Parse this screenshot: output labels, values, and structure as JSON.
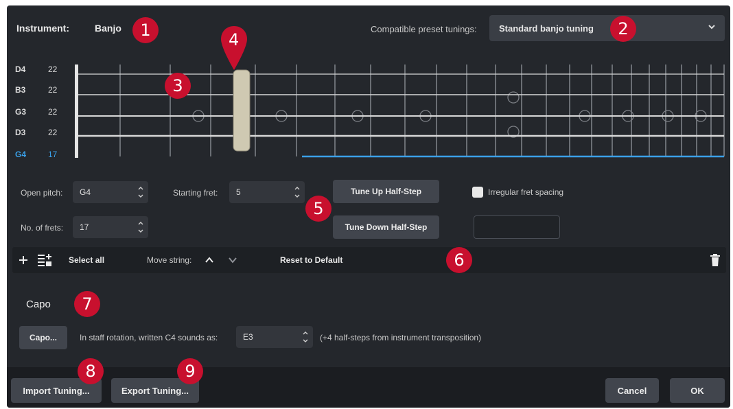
{
  "header": {
    "instrument_label": "Instrument:",
    "instrument_value": "Banjo",
    "preset_label": "Compatible preset tunings:",
    "preset_value": "Standard banjo tuning"
  },
  "strings": [
    {
      "name": "D4",
      "frets": "22",
      "highlight": false
    },
    {
      "name": "B3",
      "frets": "22",
      "highlight": false
    },
    {
      "name": "G3",
      "frets": "22",
      "highlight": false
    },
    {
      "name": "D3",
      "frets": "22",
      "highlight": false
    },
    {
      "name": "G4",
      "frets": "17",
      "highlight": true
    }
  ],
  "fields": {
    "open_pitch_label": "Open pitch:",
    "open_pitch_value": "G4",
    "starting_fret_label": "Starting fret:",
    "starting_fret_value": "5",
    "frets_label": "No. of frets:",
    "frets_value": "17",
    "tune_up": "Tune Up Half-Step",
    "tune_down": "Tune Down Half-Step",
    "irregular_label": "Irregular fret spacing"
  },
  "toolbar": {
    "select_all": "Select all",
    "move_string": "Move string:",
    "reset": "Reset to Default"
  },
  "capo": {
    "heading": "Capo",
    "button": "Capo...",
    "sounds_label": "In staff rotation, written C4 sounds as:",
    "sounds_value": "E3",
    "note": "(+4 half-steps from instrument transposition)"
  },
  "footer": {
    "import": "Import Tuning...",
    "export": "Export Tuning...",
    "cancel": "Cancel",
    "ok": "OK"
  },
  "markers": [
    "1",
    "2",
    "3",
    "4",
    "5",
    "6",
    "7",
    "8",
    "9"
  ],
  "colors": {
    "background": "#24272c",
    "accent_blue": "#3aa0e8",
    "marker_red": "#c8102e"
  }
}
